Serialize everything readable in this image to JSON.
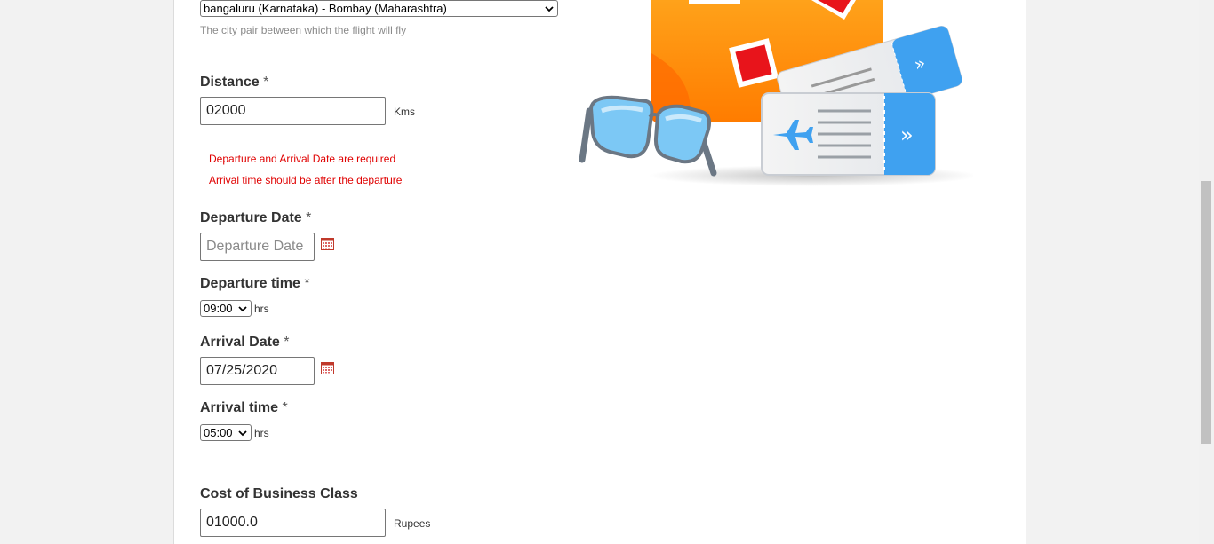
{
  "route": {
    "selected": "bangaluru (Karnataka) - Bombay (Maharashtra)",
    "hint": "The city pair between which the flight will fly"
  },
  "distance": {
    "label": "Distance",
    "required_mark": "*",
    "value": "02000",
    "unit": "Kms"
  },
  "errors": [
    "Departure and Arrival Date are required",
    "Arrival time should be after the departure"
  ],
  "departure_date": {
    "label": "Departure Date",
    "required_mark": "*",
    "value": "",
    "placeholder": "Departure Date"
  },
  "departure_time": {
    "label": "Departure time",
    "required_mark": "*",
    "selected": "09:00",
    "unit": "hrs"
  },
  "arrival_date": {
    "label": "Arrival Date",
    "required_mark": "*",
    "value": "07/25/2020"
  },
  "arrival_time": {
    "label": "Arrival time",
    "required_mark": "*",
    "selected": "05:00",
    "unit": "hrs"
  },
  "business_cost": {
    "label": "Cost of Business Class",
    "value": "01000.0",
    "unit": "Rupees"
  },
  "colors": {
    "error": "#e00000",
    "suitcase": "#ff8c00",
    "ticket_blue": "#3fa1f0"
  },
  "icons": {
    "calendar": "calendar-icon",
    "dropdown": "chevron-down-icon"
  }
}
